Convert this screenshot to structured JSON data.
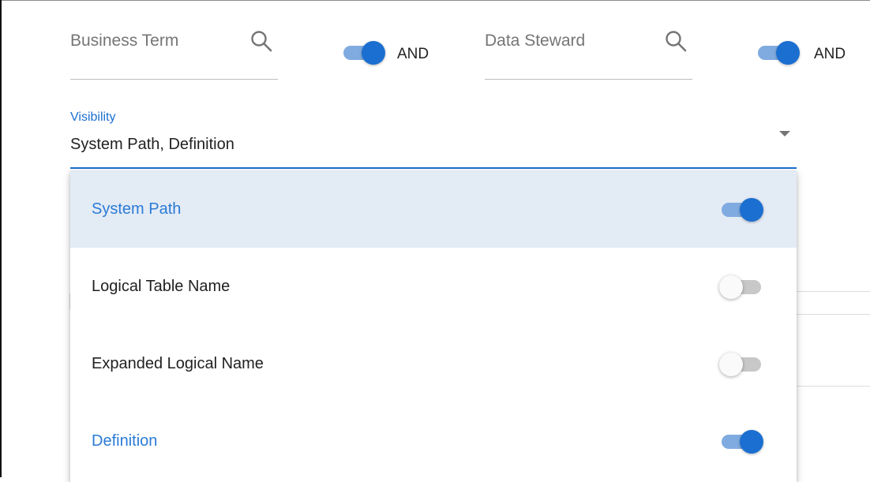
{
  "filters": {
    "business_term": {
      "label": "Business Term",
      "icon": "search-icon",
      "operator_label": "AND",
      "operator_on": true
    },
    "data_steward": {
      "label": "Data Steward",
      "icon": "search-icon",
      "operator_label": "AND",
      "operator_on": true
    }
  },
  "visibility": {
    "label": "Visibility",
    "value": "System Path, Definition",
    "icon": "arrow-drop-down-icon"
  },
  "menu": {
    "items": [
      {
        "label": "System Path",
        "enabled": true,
        "highlighted": true
      },
      {
        "label": "Logical Table Name",
        "enabled": false,
        "highlighted": false
      },
      {
        "label": "Expanded Logical Name",
        "enabled": false,
        "highlighted": false
      },
      {
        "label": "Definition",
        "enabled": true,
        "highlighted": false
      }
    ]
  },
  "colors": {
    "accent": "#1b6fd0",
    "accent_track": "#80abe0",
    "selected_row": "#e3ebf5",
    "off_track": "#c8c8c8"
  }
}
